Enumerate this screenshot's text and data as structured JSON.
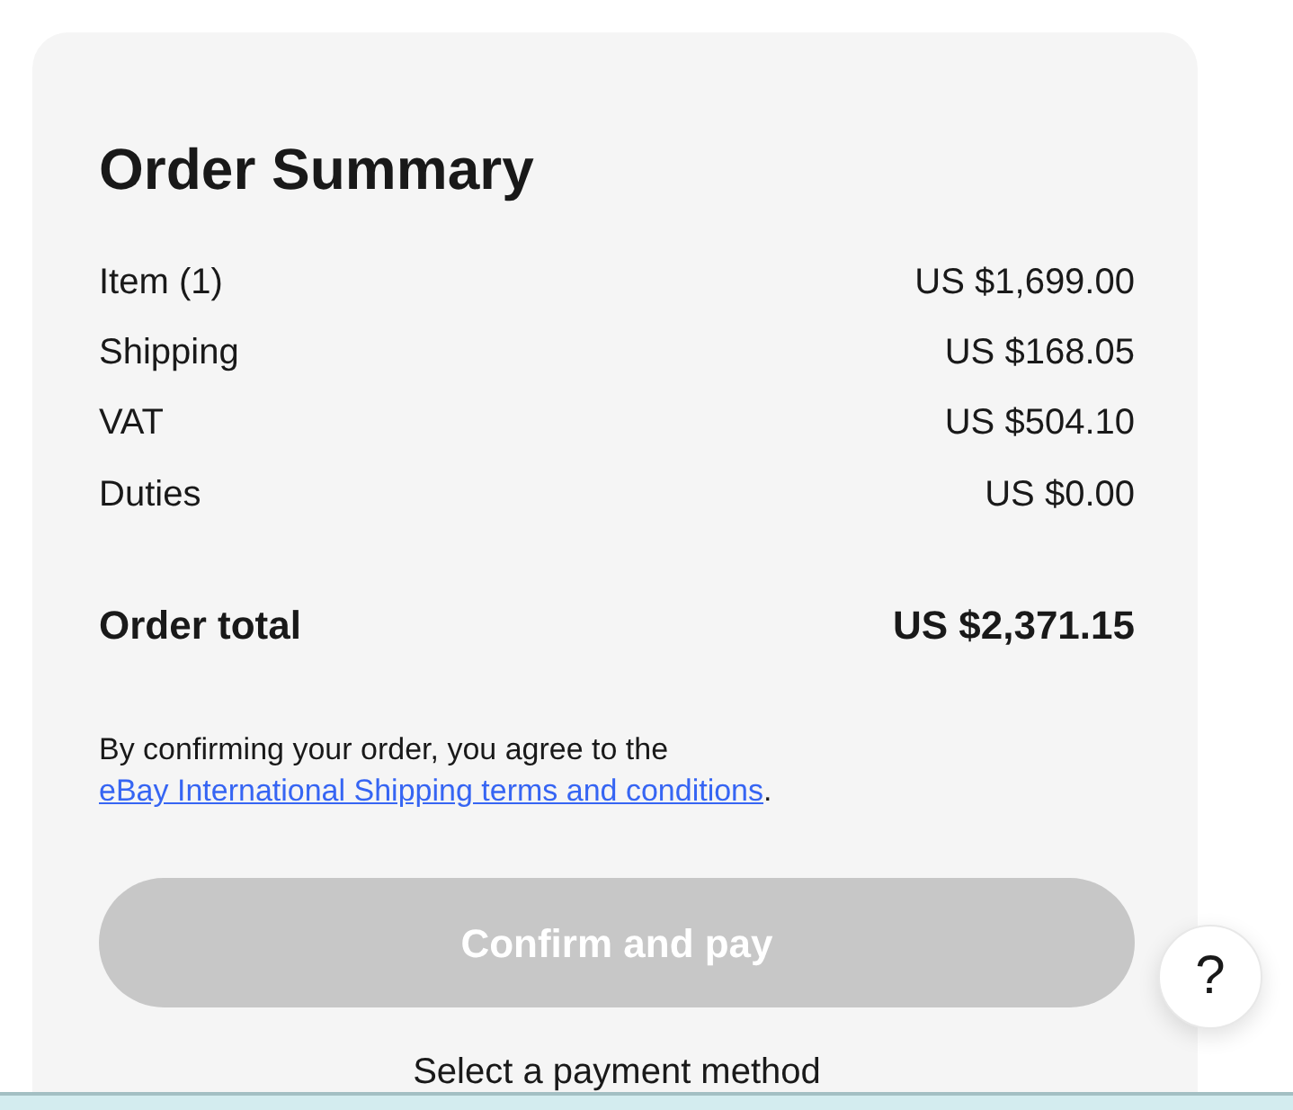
{
  "order_summary": {
    "title": "Order Summary",
    "lines": [
      {
        "label": "Item (1)",
        "amount": "US $1,699.00"
      },
      {
        "label": "Shipping",
        "amount": "US $168.05"
      },
      {
        "label": "VAT",
        "amount": "US $504.10"
      },
      {
        "label": "Duties",
        "amount": "US $0.00"
      }
    ],
    "total": {
      "label": "Order total",
      "amount": "US $2,371.15"
    },
    "agreement": {
      "text": "By confirming your order, you agree to the ",
      "link": "eBay International Shipping terms and conditions",
      "suffix": "."
    },
    "confirm_button": {
      "label": "Confirm and pay",
      "disabled": true
    },
    "payment_hint": "Select a payment method"
  },
  "help_button": {
    "label": "?"
  }
}
